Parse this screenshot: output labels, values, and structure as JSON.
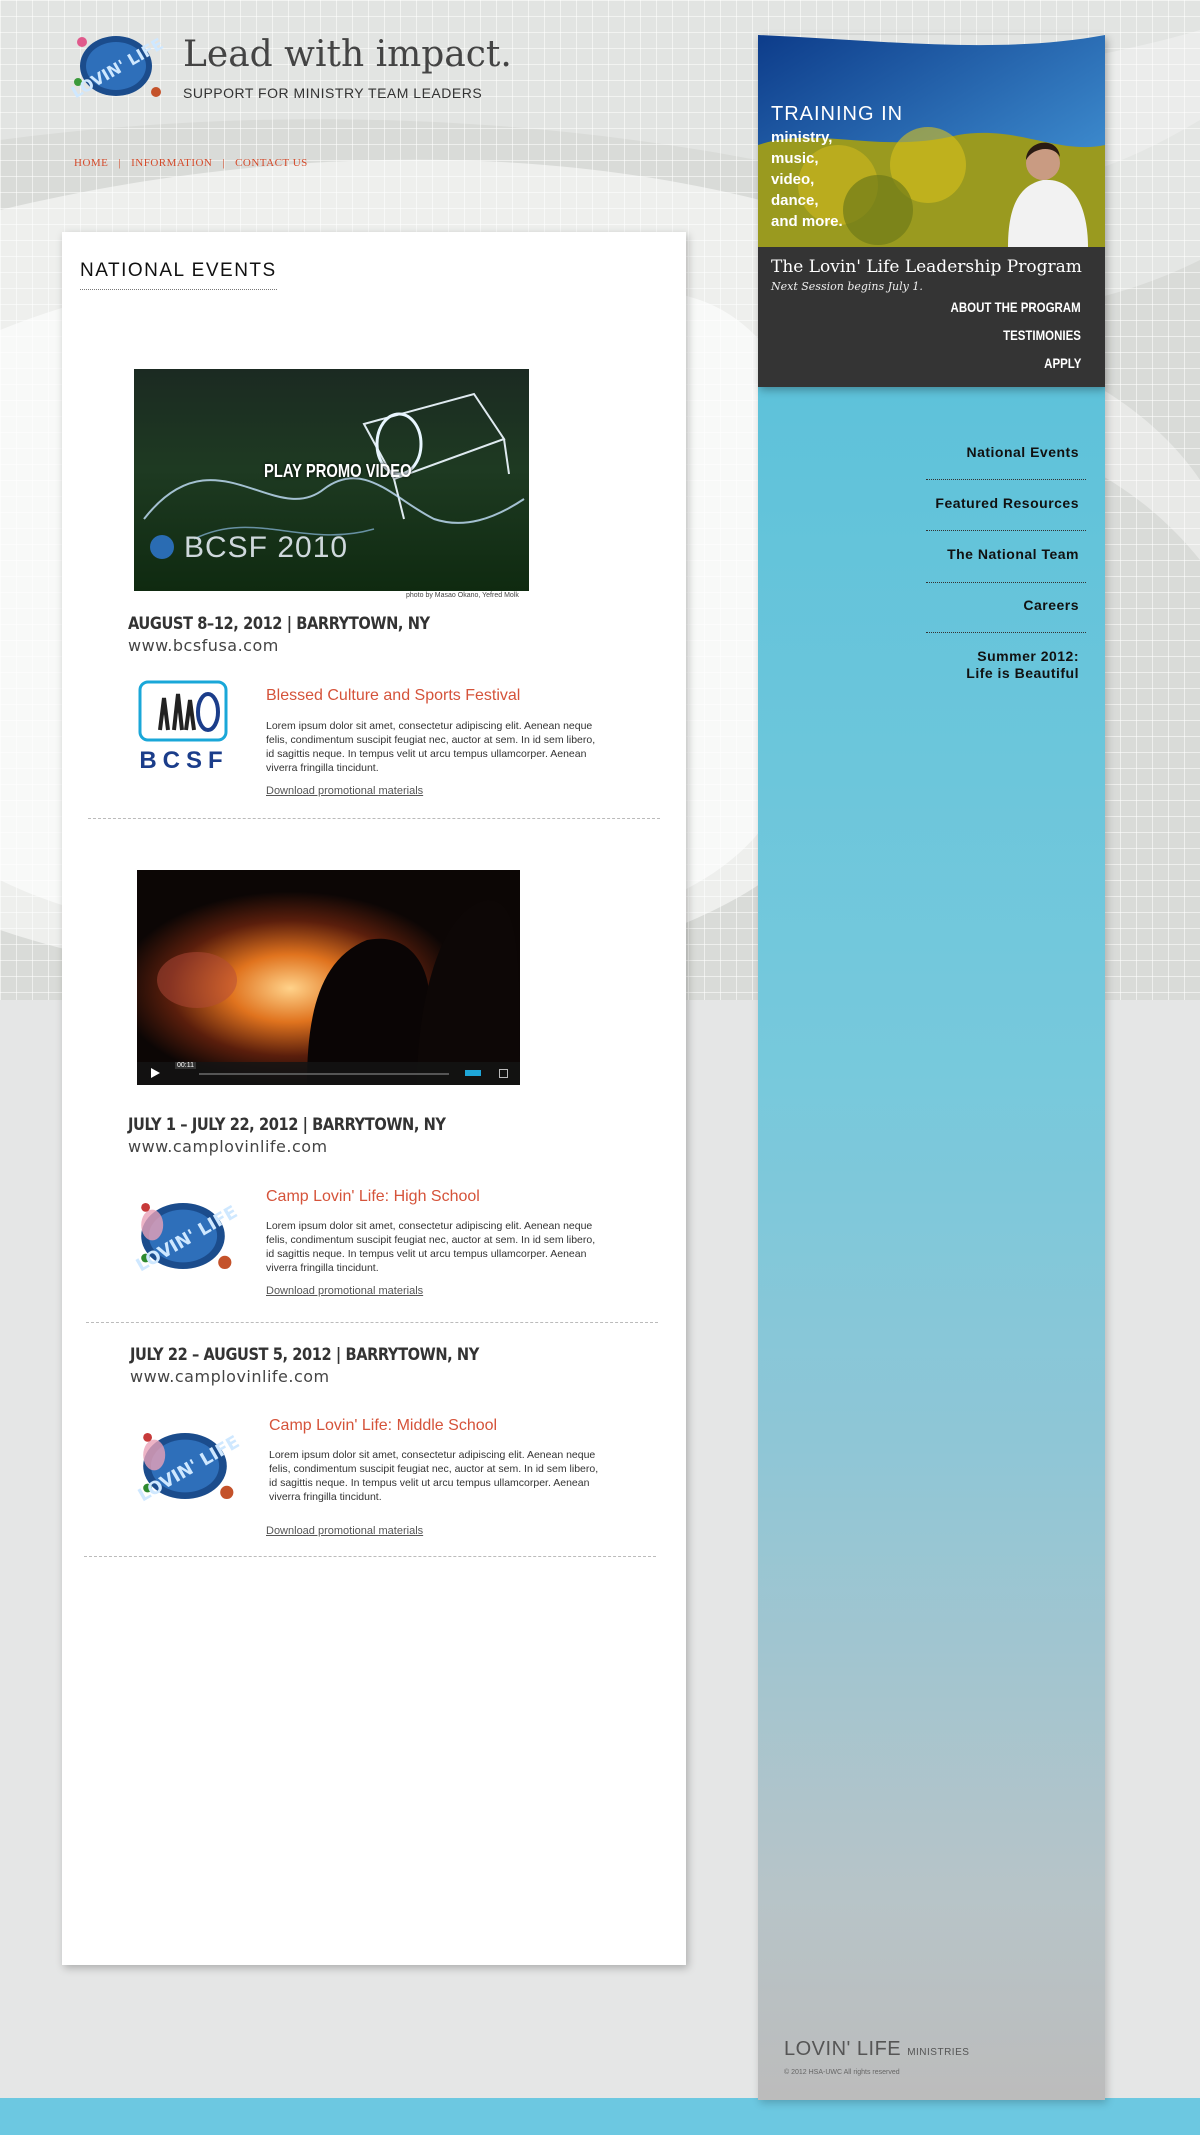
{
  "header": {
    "tagline": "Lead with impact.",
    "subtagline": "SUPPORT FOR MINISTRY TEAM LEADERS",
    "logo_text": "LOVIN' LIFE"
  },
  "topnav": {
    "items": [
      "HOME",
      "INFORMATION",
      "CONTACT US"
    ],
    "separator": "|"
  },
  "main": {
    "section_title": "NATIONAL EVENTS",
    "events": [
      {
        "video_overlay": "PLAY PROMO VIDEO",
        "video_caption": "BCSF 2010",
        "photo_credit": "photo by Masao Okano, Yefred Molk",
        "date": "AUGUST 8–12, 2012 | BARRYTOWN, NY",
        "url": "www.bcsfusa.com",
        "logo_text": "BCSF",
        "name": "Blessed Culture and Sports Festival",
        "description": "Lorem ipsum dolor sit amet, consectetur adipiscing elit. Aenean neque felis, condimentum suscipit feugiat nec, auctor at sem. In id sem libero, id sagittis neque. In tempus velit ut arcu tempus ullamcorper. Aenean viverra fringilla tincidunt.",
        "download": "Download promotional materials"
      },
      {
        "player_time": "00:11",
        "date": "JULY 1 – JULY 22, 2012 | BARRYTOWN, NY",
        "url": "www.camplovinlife.com",
        "name": "Camp Lovin' Life: High School",
        "description": "Lorem ipsum dolor sit amet, consectetur adipiscing elit. Aenean neque felis, condimentum suscipit feugiat nec, auctor at sem. In id sem libero, id sagittis neque. In tempus velit ut arcu tempus ullamcorper. Aenean viverra fringilla tincidunt.",
        "download": "Download promotional materials"
      },
      {
        "date": "JULY 22 – AUGUST 5, 2012 | BARRYTOWN, NY",
        "url": "www.camplovinlife.com",
        "name": "Camp Lovin' Life: Middle School",
        "description": "Lorem ipsum dolor sit amet, consectetur adipiscing elit. Aenean neque felis, condimentum suscipit feugiat nec, auctor at sem. In id sem libero, id sagittis neque. In tempus velit ut arcu tempus ullamcorper. Aenean viverra fringilla tincidunt.",
        "download": "Download promotional materials"
      }
    ]
  },
  "training": {
    "heading": "TRAINING IN",
    "lines": [
      "ministry,",
      "music,",
      "video,",
      "dance,",
      "and more."
    ],
    "program_title": "The Lovin' Life Leadership Program",
    "program_sub": "Next Session begins July 1.",
    "links": [
      "ABOUT THE PROGRAM",
      "TESTIMONIES",
      "APPLY"
    ]
  },
  "sidebar": {
    "items": [
      "National Events",
      "Featured Resources",
      "The National Team",
      "Careers",
      "Summer 2012:",
      "Life is Beautiful"
    ]
  },
  "footer": {
    "brand": "LOVIN' LIFE",
    "brand_small": "MINISTRIES",
    "copyright": "© 2012 HSA-UWC All rights reserved"
  },
  "colors": {
    "accent": "#d5533a",
    "sidebar_blue": "#6cc8e1",
    "panel_dark": "#343434"
  }
}
